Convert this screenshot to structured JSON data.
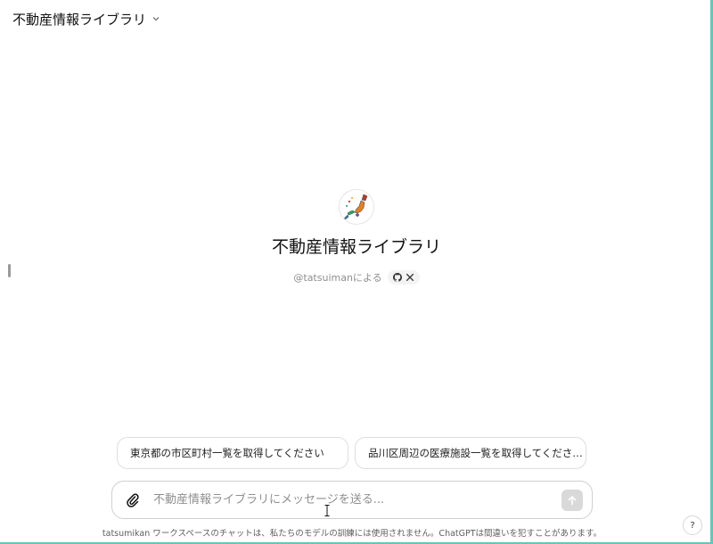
{
  "header": {
    "title": "不動産情報ライブラリ",
    "chevron_icon": "chevron-down-icon"
  },
  "gpt": {
    "name": "不動産情報ライブラリ",
    "byline": "@tatsuimanによる",
    "social_icons": [
      "github-icon",
      "x-icon"
    ]
  },
  "suggestions": [
    {
      "label": "東京都の市区町村一覧を取得してください"
    },
    {
      "label": "品川区周辺の医療施設一覧を取得してくださ…"
    }
  ],
  "composer": {
    "placeholder": "不動産情報ライブラリにメッセージを送る...",
    "value": "",
    "attach_icon": "paperclip-icon",
    "send_icon": "arrow-up-icon"
  },
  "footer": {
    "disclaimer": "tatsumikan ワークスペースのチャットは、私たちのモデルの訓練には使用されません。ChatGPTは間違いを犯すことがあります。",
    "help_label": "?"
  },
  "colors": {
    "frame_edge": "#5fc9b8",
    "send_disabled": "#d9d9d9"
  }
}
